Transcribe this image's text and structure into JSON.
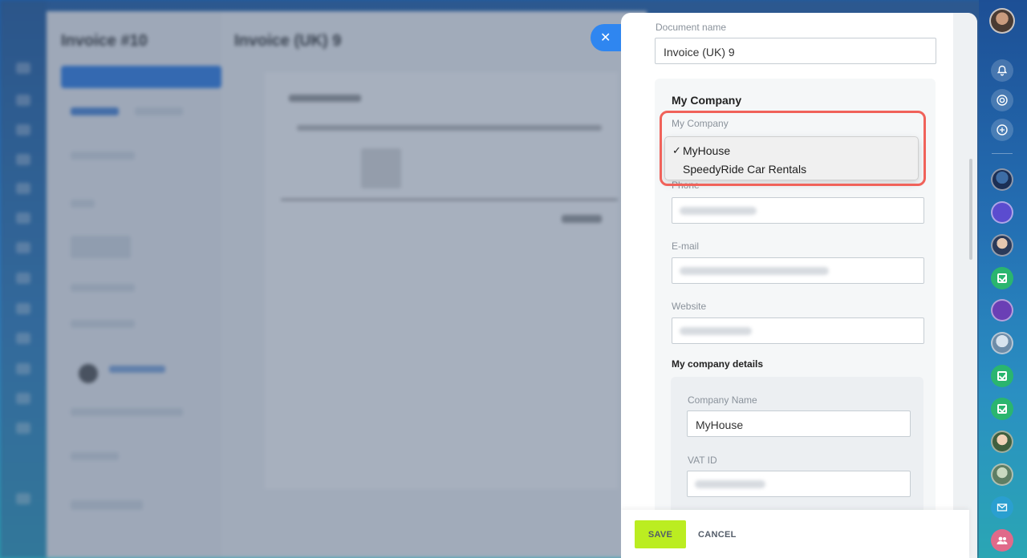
{
  "colors": {
    "accent_blue": "#2f86f0",
    "save_green": "#bbed21",
    "highlight_red": "#f0625a",
    "task_green": "#2ab56f"
  },
  "background": {
    "left_title": "Invoice #10",
    "main_title": "Invoice (UK) 9"
  },
  "close_button": {
    "icon": "close-icon",
    "glyph": "✕"
  },
  "form": {
    "document_name": {
      "label": "Document name",
      "value": "Invoice (UK) 9"
    },
    "my_company_section": {
      "title": "My Company",
      "select_label": "My Company",
      "options": [
        {
          "label": "MyHouse",
          "selected": true
        },
        {
          "label": "SpeedyRide Car Rentals",
          "selected": false
        }
      ]
    },
    "phone": {
      "label": "Phone"
    },
    "email": {
      "label": "E-mail"
    },
    "website": {
      "label": "Website"
    },
    "details": {
      "title": "My company details",
      "company_name": {
        "label": "Company Name",
        "value": "MyHouse"
      },
      "vat_id": {
        "label": "VAT ID"
      }
    }
  },
  "footer": {
    "save_label": "SAVE",
    "cancel_label": "CANCEL"
  },
  "right_rail": {
    "items": [
      "user-avatar",
      "bell-icon",
      "copilot-icon",
      "chat-search-icon",
      "contact-avatar",
      "copilot-avatar",
      "contact-avatar",
      "task-icon",
      "support-icon",
      "contact-avatar",
      "task-icon",
      "task-icon",
      "contact-avatar",
      "contact-avatar",
      "mail-icon",
      "group-icon"
    ]
  }
}
